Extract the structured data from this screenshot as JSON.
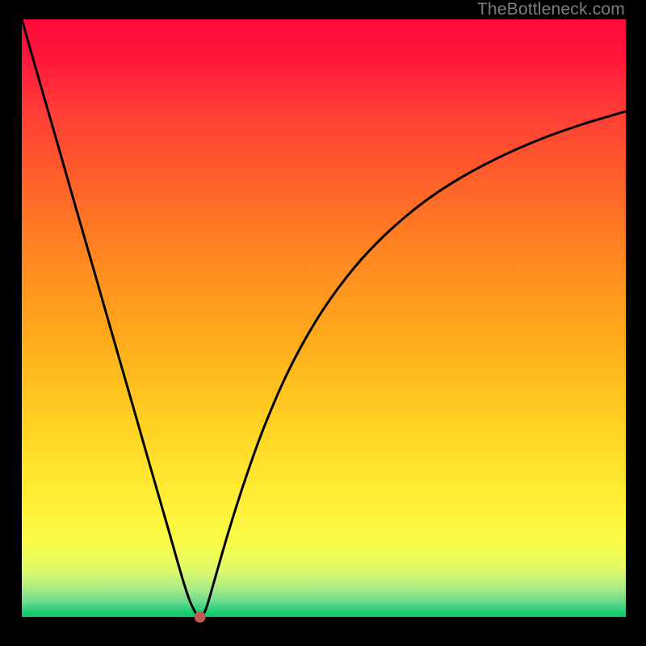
{
  "watermark": "TheBottleneck.com",
  "chart_data": {
    "type": "line",
    "title": "",
    "xlabel": "",
    "ylabel": "",
    "xlim": [
      0,
      100
    ],
    "ylim": [
      0,
      100
    ],
    "grid": false,
    "legend": false,
    "background_gradient": [
      "#ff0a3a",
      "#ff5a2c",
      "#ffaa1c",
      "#ffe72f",
      "#10c963"
    ],
    "marker": {
      "x": 29.5,
      "y": 0,
      "color": "#c05a54",
      "radius_px": 7
    },
    "series": [
      {
        "name": "curve",
        "color": "#000000",
        "x": [
          0,
          3,
          6,
          9,
          12,
          15,
          18,
          21,
          24,
          27,
          28.5,
          29.5,
          30.5,
          32,
          34,
          36,
          38,
          40,
          43,
          46,
          50,
          55,
          60,
          66,
          72,
          79,
          86,
          93,
          100
        ],
        "y": [
          100,
          89.4,
          78.9,
          68.3,
          57.8,
          47.2,
          36.7,
          26.1,
          15.6,
          5.1,
          1.2,
          0,
          1.4,
          6.5,
          13.5,
          20.0,
          26.0,
          31.5,
          38.7,
          44.8,
          51.6,
          58.4,
          63.8,
          69.0,
          73.1,
          76.9,
          80.0,
          82.5,
          84.6
        ]
      }
    ]
  }
}
